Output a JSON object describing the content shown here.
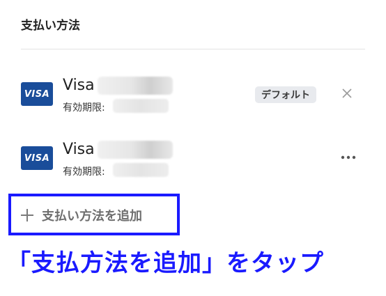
{
  "section": {
    "title": "支払い方法"
  },
  "cards": [
    {
      "logo_text": "VISA",
      "brand": "Visa",
      "expiry_label": "有効期限:",
      "badge": "デフォルト",
      "action_icon": "close-icon"
    },
    {
      "logo_text": "VISA",
      "brand": "Visa",
      "expiry_label": "有効期限:",
      "action_icon": "more-icon"
    }
  ],
  "add_payment": {
    "label": "支払い方法を追加",
    "icon": "plus-icon"
  },
  "annotation": {
    "text": "「支払方法を追加」をタップ",
    "color": "#1a1aff"
  },
  "colors": {
    "visa_blue": "#1a4d9a",
    "highlight": "#1a1aff"
  }
}
